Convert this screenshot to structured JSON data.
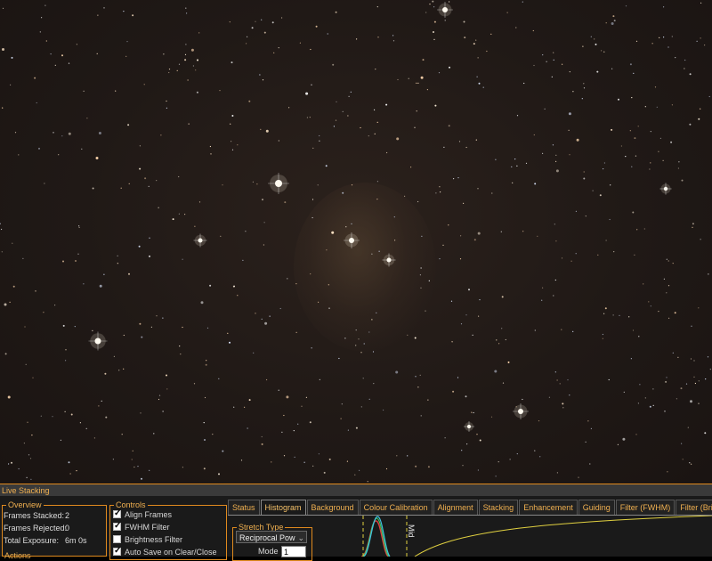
{
  "panel": {
    "title": "Live Stacking",
    "overview": {
      "legend": "Overview",
      "frames_stacked_label": "Frames Stacked:",
      "frames_stacked_value": "2",
      "frames_rejected_label": "Frames Rejected:",
      "frames_rejected_value": "0",
      "total_exposure_label": "Total Exposure:",
      "total_exposure_value": "6m 0s",
      "partial_label": "Actions"
    },
    "controls": {
      "legend": "Controls",
      "items": [
        {
          "label": "Align Frames",
          "checked": true
        },
        {
          "label": "FWHM Filter",
          "checked": true
        },
        {
          "label": "Brightness Filter",
          "checked": false
        },
        {
          "label": "Auto Save on Clear/Close",
          "checked": true
        }
      ]
    },
    "tabs": [
      "Status",
      "Histogram",
      "Background",
      "Colour Calibration",
      "Alignment",
      "Stacking",
      "Enhancement",
      "Guiding",
      "Filter (FWHM)",
      "Filter (Brightness)"
    ],
    "active_tab": "Histogram",
    "histogram": {
      "stretch_legend": "Stretch Type",
      "stretch_value": "Reciprocal Pow",
      "mode_label": "Mode",
      "mode_value": "1",
      "mid_marker_label": "Mid",
      "colors": {
        "red": "#e04040",
        "green": "#40c060",
        "cyan": "#40c0e0",
        "curve": "#e0d040",
        "marker": "#e0d040"
      }
    }
  },
  "colors": {
    "accent": "#e08a1e",
    "accent_text": "#f0b050"
  }
}
